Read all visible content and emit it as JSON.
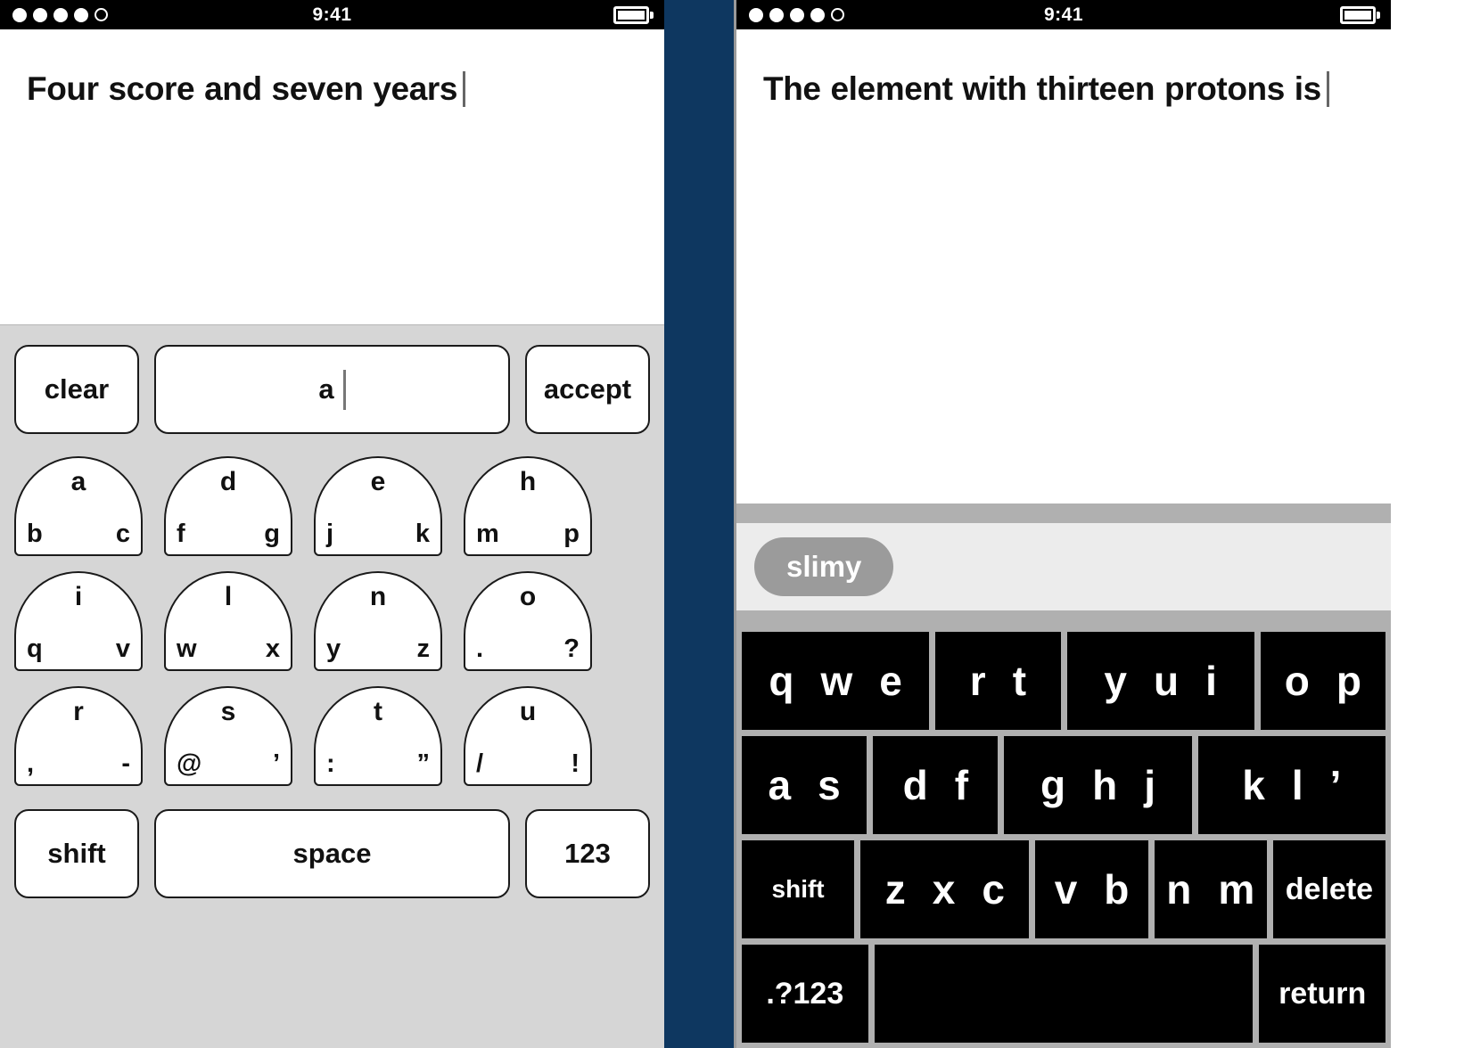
{
  "left_phone": {
    "status_bar": {
      "signal_dots": [
        "filled",
        "filled",
        "filled",
        "filled",
        "hollow"
      ],
      "time": "9:41",
      "battery_level_pct": 88,
      "battery_icon": "battery-icon"
    },
    "document": {
      "text": "Four score and seven years",
      "caret_visible": true
    },
    "keyboard": {
      "type": "arch-multitap",
      "top_row": {
        "clear_label": "clear",
        "composed_word": "a",
        "accept_label": "accept"
      },
      "letter_rows": [
        [
          {
            "top": "a",
            "bl": "b",
            "br": "c"
          },
          {
            "top": "d",
            "bl": "f",
            "br": "g"
          },
          {
            "top": "e",
            "bl": "j",
            "br": "k"
          },
          {
            "top": "h",
            "bl": "m",
            "br": "p"
          }
        ],
        [
          {
            "top": "i",
            "bl": "q",
            "br": "v"
          },
          {
            "top": "l",
            "bl": "w",
            "br": "x"
          },
          {
            "top": "n",
            "bl": "y",
            "br": "z"
          },
          {
            "top": "o",
            "bl": ".",
            "br": "?"
          }
        ],
        [
          {
            "top": "r",
            "bl": ",",
            "br": "-"
          },
          {
            "top": "s",
            "bl": "@",
            "br": "’"
          },
          {
            "top": "t",
            "bl": ":",
            "br": "”"
          },
          {
            "top": "u",
            "bl": "/",
            "br": "!"
          }
        ]
      ],
      "bottom_row": {
        "shift_label": "shift",
        "space_label": "space",
        "numeric_label": "123"
      }
    }
  },
  "right_phone": {
    "status_bar": {
      "signal_dots": [
        "filled",
        "filled",
        "filled",
        "filled",
        "hollow"
      ],
      "time": "9:41",
      "battery_level_pct": 88,
      "battery_icon": "battery-icon"
    },
    "document": {
      "text": "The element with thirteen protons is",
      "caret_visible": true
    },
    "suggestion_bar": {
      "suggestions": [
        "slimy"
      ]
    },
    "keyboard": {
      "type": "qwerty-grouped",
      "rows": [
        {
          "keys": [
            {
              "label": "q w e",
              "letters": [
                "q",
                "w",
                "e"
              ],
              "flex": 3,
              "kind": "letters"
            },
            {
              "label": "r t",
              "letters": [
                "r",
                "t"
              ],
              "flex": 2,
              "kind": "letters"
            },
            {
              "label": "y u i",
              "letters": [
                "y",
                "u",
                "i"
              ],
              "flex": 3,
              "kind": "letters"
            },
            {
              "label": "o p",
              "letters": [
                "o",
                "p"
              ],
              "flex": 2,
              "kind": "letters"
            }
          ]
        },
        {
          "keys": [
            {
              "label": "a s",
              "letters": [
                "a",
                "s"
              ],
              "flex": 2,
              "kind": "letters"
            },
            {
              "label": "d f",
              "letters": [
                "d",
                "f"
              ],
              "flex": 2,
              "kind": "letters"
            },
            {
              "label": "g h j",
              "letters": [
                "g",
                "h",
                "j"
              ],
              "flex": 3,
              "kind": "letters"
            },
            {
              "label": "k l ’",
              "letters": [
                "k",
                "l",
                "’"
              ],
              "flex": 3,
              "kind": "letters"
            }
          ]
        },
        {
          "keys": [
            {
              "label": "shift",
              "flex": 2,
              "kind": "modifier"
            },
            {
              "label": "z x c",
              "letters": [
                "z",
                "x",
                "c"
              ],
              "flex": 3,
              "kind": "letters"
            },
            {
              "label": "v b",
              "letters": [
                "v",
                "b"
              ],
              "flex": 2,
              "kind": "letters"
            },
            {
              "label": "n m",
              "letters": [
                "n",
                "m"
              ],
              "flex": 2,
              "kind": "letters"
            },
            {
              "label": "delete",
              "flex": 2,
              "kind": "modifier"
            }
          ]
        },
        {
          "keys": [
            {
              "label": ".?123",
              "flex": 2,
              "kind": "modifier"
            },
            {
              "label": "",
              "flex": 6,
              "kind": "space"
            },
            {
              "label": "return",
              "flex": 2,
              "kind": "modifier"
            }
          ]
        }
      ]
    }
  },
  "colors": {
    "divider": "#0e3760",
    "left_keyboard_bg": "#d6d6d6",
    "right_keyboard_bg": "#b0b0b0",
    "key_black": "#000000",
    "suggestion_pill": "#9b9b9b",
    "suggestion_strip": "#ececec"
  }
}
